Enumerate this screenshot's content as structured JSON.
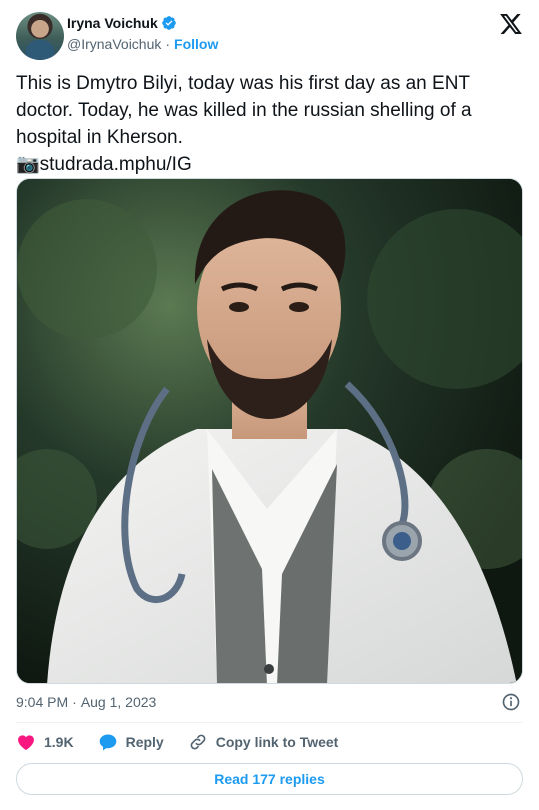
{
  "author": {
    "display_name": "Iryna Voichuk",
    "handle": "@IrynaVoichuk",
    "separator": "·",
    "follow_label": "Follow",
    "verified": true
  },
  "tweet": {
    "text_line_1": "This is Dmytro Bilyi, today was his first day as an ENT doctor. Today, he was killed in the russian shelling of a hospital in Kherson.",
    "text_line_2": "📷studrada.mphu/IG",
    "time": "9:04 PM",
    "dot": "·",
    "date": "Aug 1, 2023"
  },
  "actions": {
    "like_count": "1.9K",
    "reply_label": "Reply",
    "copy_link_label": "Copy link to Tweet"
  },
  "read_replies_label": "Read 177 replies",
  "colors": {
    "accent": "#1d9bf0",
    "like": "#f91880",
    "text": "#0f1419",
    "muted": "#536471"
  }
}
